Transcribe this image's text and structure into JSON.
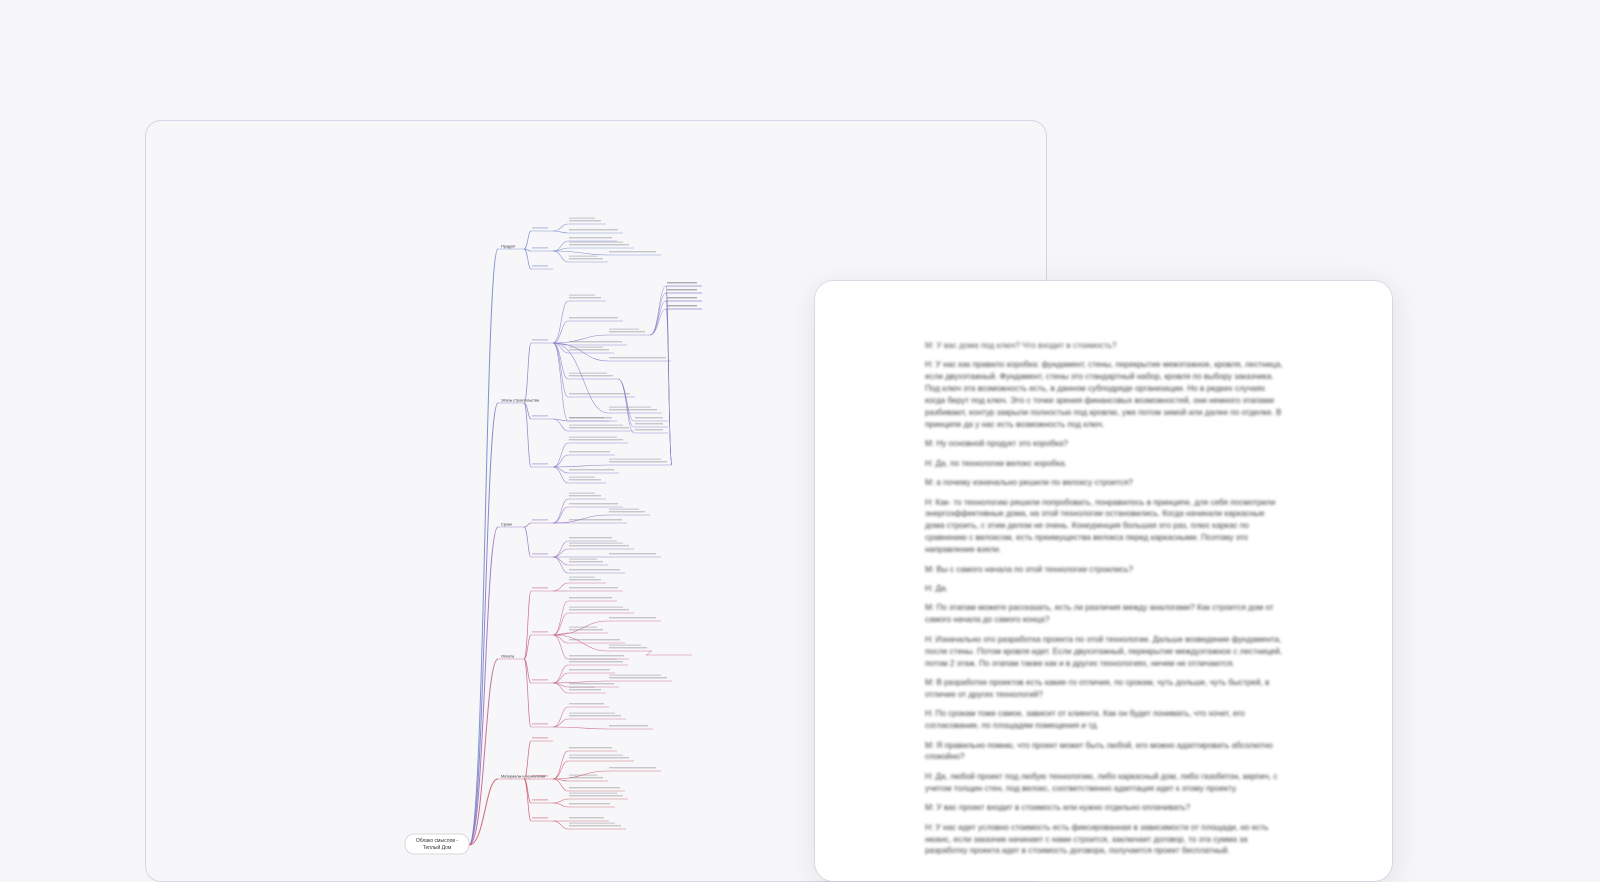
{
  "mindmap": {
    "root": "Облако смыслов - Теплый Дом",
    "branches": [
      {
        "label": "Продукт",
        "color": "#6a7fc8"
      },
      {
        "label": "Этапы строительства",
        "color": "#7a73c4"
      },
      {
        "label": "Сроки",
        "color": "#8d6ab8"
      },
      {
        "label": "Оплата",
        "color": "#c0568a"
      },
      {
        "label": "Материалы и технологии",
        "color": "#c44e5e"
      }
    ]
  },
  "transcript": {
    "paragraphs": [
      "М: У вас дома под ключ? Что входит в стоимость?",
      "Н: У нас как правило коробка: фундамент, стены, перекрытие межэтажное, кровля, лестница, если двухэтажный. Фундамент, стены это стандартный набор, кровля по выбору заказчика. Под ключ эта возможность есть, в данном субподряде организации. Но в редких случаях когда берут под ключ. Это с точки зрения финансовых возможностей, они немного этапами разбивают, контур закрыли полностью под кровлю, уже потом зимой или далее по отделке. В принципе да у нас есть возможность под ключ.",
      "М: Ну основной продукт это коробка?",
      "Н: Да, по технологии велокс коробка.",
      "М: а почему изначально решили по велоксу строится?",
      "Н: Как- то технологию решили попробовать, понравилось в принципе, для себя посмотрели энергоэффективные дома, на этой технологии остановились. Когда начинали каркасные дома строить, с этим делом не очень. Конкуренция большая это раз, плюс каркас по сравнению с велоксом, есть преимущества велокса перед каркасными. Поэтому это направление взяли.",
      "М: Вы с самого начала по этой технологии строились?",
      "Н: Да.",
      "М: По этапам можете рассказать, есть ли различия между аналогами? Как строится дом от самого начала до самого конца?",
      "Н: Изначально это разработка проекта по этой технологии. Дальше возведение фундамента, после стены. Потом кровля идет. Если двухэтажный, перекрытие междуэтажное с лестницей, потом 2 этаж. По этапам также как и в других технологиях, ничем не отличаются.",
      "М: В разработке проектов есть какие-то отличия, по срокам, чуть дольше, чуть быстрей, в отличие от других технологий?",
      "Н: По срокам тоже самое, зависит от клиента. Как он будет понимать, что хочет, его согласование, по площадям помещения и тд.",
      "М: Я правильно помню, что проект может быть любой, его можно адаптировать абсолютно спокойно?",
      "Н: Да, любой проект под любую технологию, либо каркасный дом, либо газобетон, кирпич, с учетом толщин стен, под велокс, соответственно адаптация идет к этому проекту.",
      "М: У вас проект входит в стоимость или нужно отдельно оплачивать?",
      "Н: У нас идет условно стоимость есть фиксированная в зависимости от площади, но есть нюанс, если заказчик начинает с нами строится, заключает договор, то эта сумма за разработку проекта идет в стоимость договора, получается проект бесплатный."
    ]
  }
}
